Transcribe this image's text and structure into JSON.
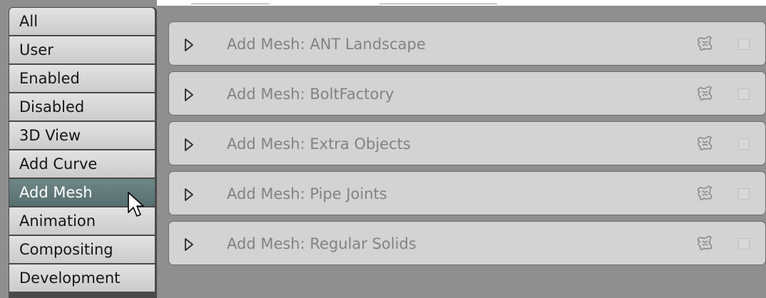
{
  "categories": [
    {
      "label": "All",
      "active": false
    },
    {
      "label": "User",
      "active": false
    },
    {
      "label": "Enabled",
      "active": false
    },
    {
      "label": "Disabled",
      "active": false
    },
    {
      "label": "3D View",
      "active": false
    },
    {
      "label": "Add Curve",
      "active": false
    },
    {
      "label": "Add Mesh",
      "active": true
    },
    {
      "label": "Animation",
      "active": false
    },
    {
      "label": "Compositing",
      "active": false
    },
    {
      "label": "Development",
      "active": false
    }
  ],
  "addons": [
    {
      "name": "Add Mesh: ANT Landscape",
      "expand_icon": "triangle-right-icon",
      "type_icon": "plugin-icon",
      "enabled": false
    },
    {
      "name": "Add Mesh: BoltFactory",
      "expand_icon": "triangle-right-icon",
      "type_icon": "plugin-icon",
      "enabled": false
    },
    {
      "name": "Add Mesh: Extra Objects",
      "expand_icon": "triangle-right-icon",
      "type_icon": "plugin-icon",
      "enabled": false
    },
    {
      "name": "Add Mesh: Pipe Joints",
      "expand_icon": "triangle-right-icon",
      "type_icon": "plugin-icon",
      "enabled": false
    },
    {
      "name": "Add Mesh: Regular Solids",
      "expand_icon": "triangle-right-icon",
      "type_icon": "plugin-icon",
      "enabled": false
    }
  ],
  "colors": {
    "active_category": "#5f7878",
    "panel_bg": "#d3d3d3",
    "window_bg": "#8f8f8f"
  }
}
